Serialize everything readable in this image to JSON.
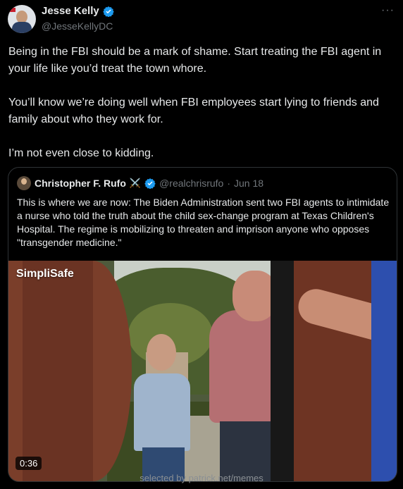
{
  "tweet": {
    "author_name": "Jesse Kelly",
    "author_handle": "@JesseKellyDC",
    "more_label": "···",
    "paragraphs": [
      "Being in the FBI should be a mark of shame. Start treating the FBI agent in your life like you’d treat the town whore.",
      "You’ll know we’re doing well when FBI employees start lying to friends and family about who they work for.",
      "I’m not even close to kidding."
    ]
  },
  "quote": {
    "author_name": "Christopher F. Rufo",
    "emoji": "⚔️",
    "author_handle": "@realchrisrufo",
    "separator": "·",
    "date": "Jun 18",
    "text": "This is where we are now: The Biden Administration sent two FBI agents to intimidate a nurse who told the truth about the child sex-change program at Texas Children's Hospital. The regime is mobilizing to threaten and imprison anyone who opposes \"transgender medicine.\"",
    "video": {
      "overlay_label": "SimpliSafe",
      "duration": "0:36"
    }
  },
  "watermark": "selected by patrick.net/memes",
  "colors": {
    "background": "#000000",
    "text": "#e7e9ea",
    "muted": "#71767b",
    "verified": "#1d9bf0",
    "border": "#2f3336"
  }
}
